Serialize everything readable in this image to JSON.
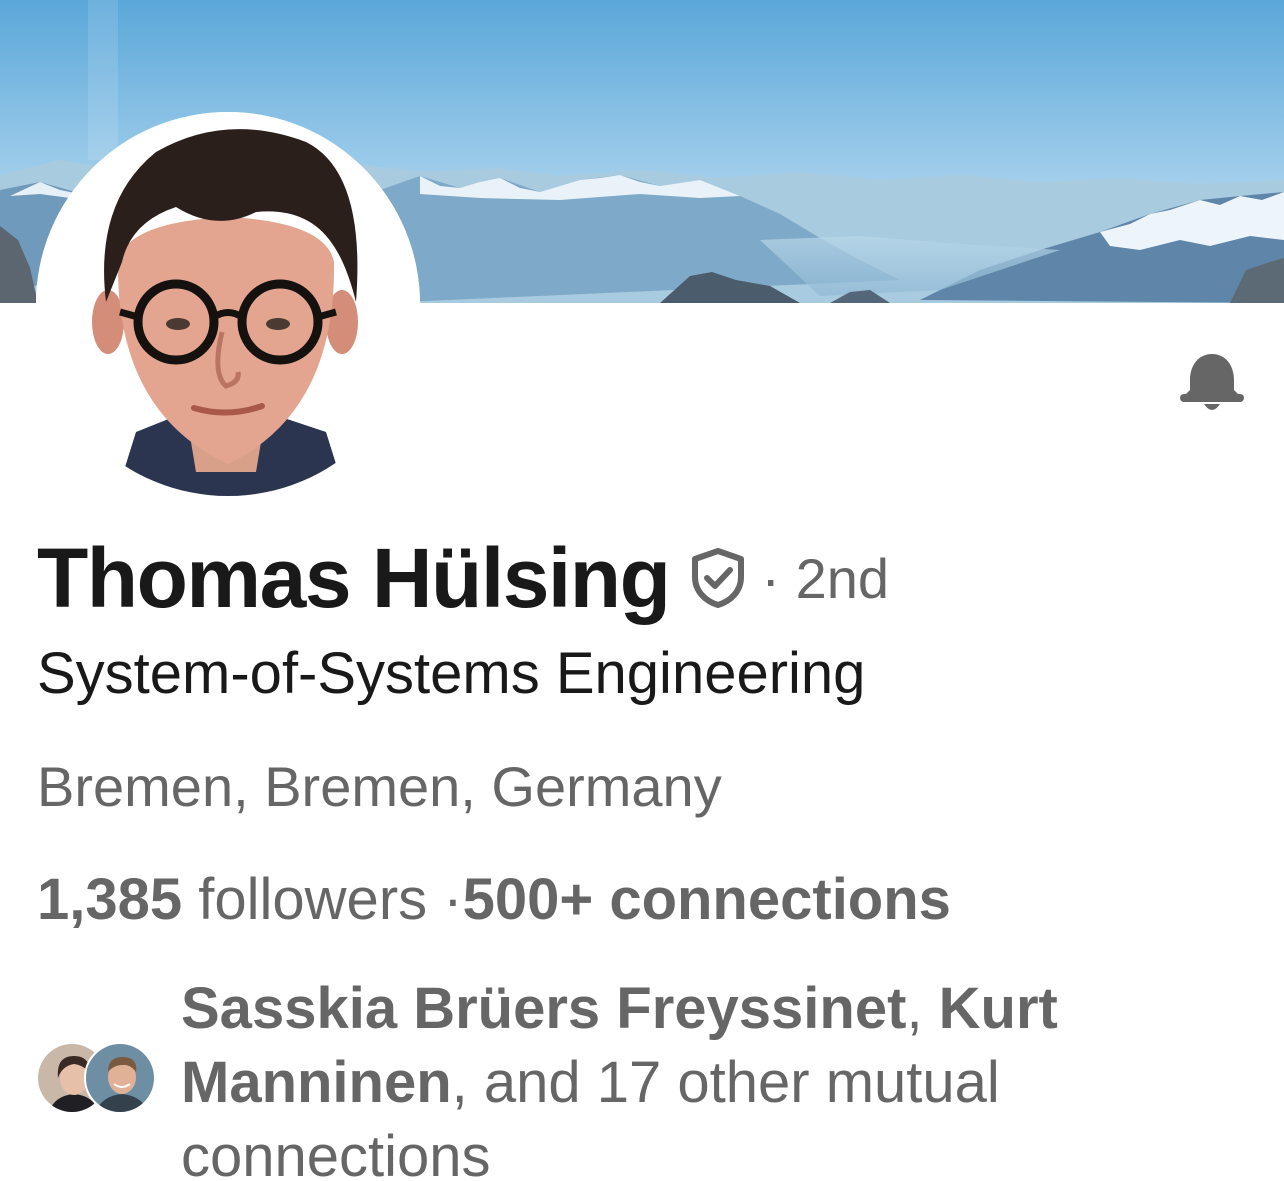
{
  "profile": {
    "name": "Thomas Hülsing",
    "degree": "· 2nd",
    "headline": "System-of-Systems Engineering",
    "location": "Bremen, Bremen, Germany",
    "followers_count": "1,385",
    "followers_label": " followers ·",
    "connections": "500+ connections"
  },
  "mutual": {
    "name1": "Sasskia Brüers Freyssinet",
    "sep": ", ",
    "name2": "Kurt Manninen",
    "rest": ", and 17 other mutual connections"
  },
  "icons": {
    "verified": "shield-check-icon",
    "notify": "bell-icon"
  },
  "colors": {
    "text_primary": "#191919",
    "text_secondary": "#666666",
    "sky_top": "#5aa7d9",
    "sky_bottom": "#c9e3f2"
  }
}
